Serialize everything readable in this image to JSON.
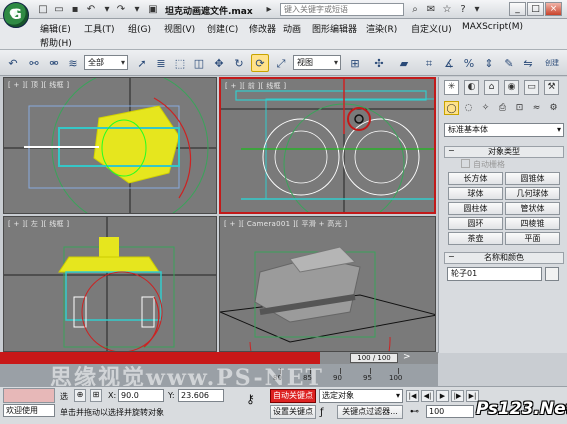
{
  "title_bar": {
    "document_title": "坦克动画遮文件.max",
    "search_placeholder": "键入关键字或短语"
  },
  "menu": {
    "row1": [
      "编辑(E)",
      "工具(T)",
      "组(G)",
      "视图(V)",
      "创建(C)",
      "修改器",
      "动画",
      "图形编辑器",
      "渲染(R)",
      "自定义(U)",
      "MAXScript(M)"
    ],
    "row2": [
      "帮助(H)"
    ]
  },
  "toolbar": {
    "selection_filter": "全部",
    "reference_coord": "视图"
  },
  "viewports": {
    "top": "[ + ][ 顶 ][ 线框 ]",
    "front": "[ + ][ 前 ][ 线框 ]",
    "left": "[ + ][ 左 ][ 线框 ]",
    "camera": "[ + ][ Camera001 ][ 平滑 + 高光 ]"
  },
  "command_panel": {
    "category_dropdown": "标准基本体",
    "object_type_header": "对象类型",
    "auto_grid": "自动栅格",
    "buttons": [
      [
        "长方体",
        "圆锥体"
      ],
      [
        "球体",
        "几何球体"
      ],
      [
        "圆柱体",
        "管状体"
      ],
      [
        "圆环",
        "四棱锥"
      ],
      [
        "茶壶",
        "平面"
      ]
    ],
    "name_color_header": "名称和颜色",
    "name_value": "轮子01"
  },
  "timeline": {
    "frame_indicator": "100 / 100",
    "ticks": [
      "80",
      "85",
      "90",
      "95",
      "100"
    ]
  },
  "status_bar": {
    "welcome": "欢迎使用",
    "selected_label": "选",
    "prompt": "单击并拖动以选择并旋转对象",
    "x_label": "X:",
    "x_value": "90.0",
    "y_label": "Y:",
    "y_value": "23.606",
    "auto_key": "自动关键点",
    "set_key": "设置关键点",
    "selection_set": "选定对象",
    "key_filters": "关键点过滤器...",
    "current_frame": "100"
  },
  "watermark": "思缘视觉www.PS-NET",
  "corner_logo": "Ps123.Net",
  "colors": {
    "viewport_bg": "#7a7a7a",
    "active_border": "#c21a1a",
    "auto_key": "#dd2222",
    "highlight": "#ffe28a"
  }
}
